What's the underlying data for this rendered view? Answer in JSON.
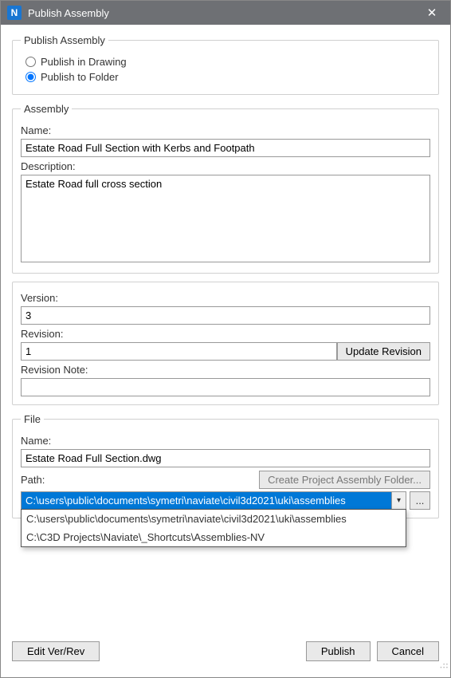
{
  "window": {
    "title": "Publish Assembly",
    "app_icon_letter": "N"
  },
  "publish_group": {
    "legend": "Publish Assembly",
    "options": [
      {
        "label": "Publish in Drawing",
        "checked": false
      },
      {
        "label": "Publish to Folder",
        "checked": true
      }
    ]
  },
  "assembly": {
    "legend": "Assembly",
    "name_label": "Name:",
    "name_value": "Estate Road Full Section with Kerbs and Footpath",
    "desc_label": "Description:",
    "desc_value": "Estate Road full cross section"
  },
  "version_block": {
    "version_label": "Version:",
    "version_value": "3",
    "revision_label": "Revision:",
    "revision_value": "1",
    "update_revision_btn": "Update Revision",
    "revision_note_label": "Revision Note:",
    "revision_note_value": ""
  },
  "file": {
    "legend": "File",
    "name_label": "Name:",
    "name_value": "Estate Road Full Section.dwg",
    "path_label": "Path:",
    "create_folder_btn": "Create Project Assembly Folder...",
    "path_value": "C:\\users\\public\\documents\\symetri\\naviate\\civil3d2021\\uki\\assemblies",
    "browse_btn": "...",
    "dropdown_items": [
      "C:\\users\\public\\documents\\symetri\\naviate\\civil3d2021\\uki\\assemblies",
      "C:\\C3D Projects\\Naviate\\_Shortcuts\\Assemblies-NV"
    ]
  },
  "footer": {
    "edit_btn": "Edit Ver/Rev",
    "publish_btn": "Publish",
    "cancel_btn": "Cancel"
  }
}
